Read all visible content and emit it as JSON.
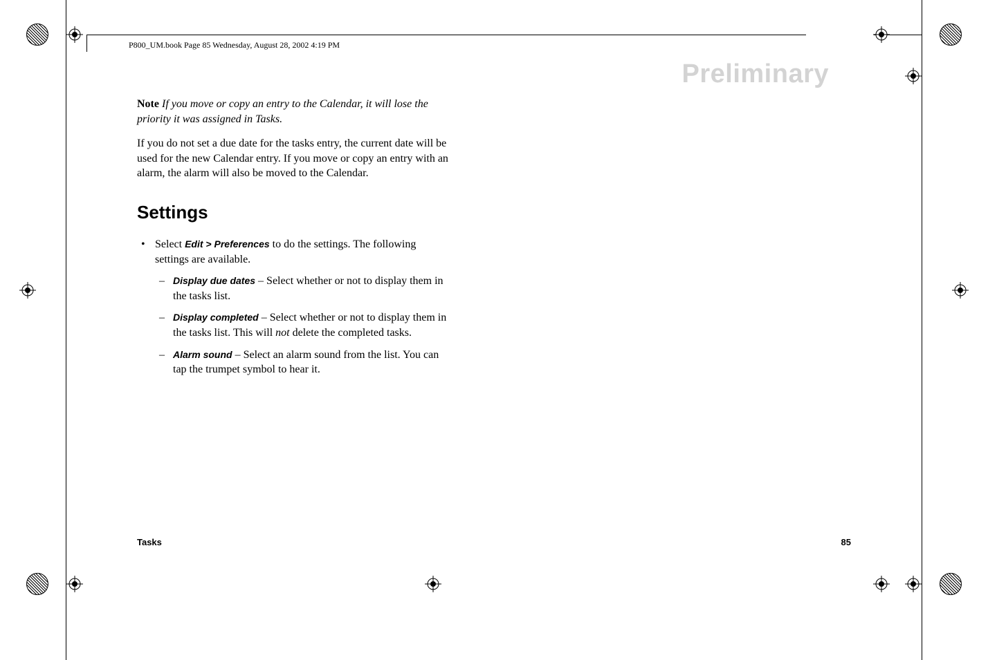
{
  "header": {
    "bookline": "P800_UM.book  Page 85  Wednesday, August 28, 2002  4:19 PM"
  },
  "watermark": "Preliminary",
  "note": {
    "label": "Note",
    "text": " If you move or copy an entry to the Calendar, it will lose the priority it was assigned in Tasks."
  },
  "body_para": "If you do not set a due date for the tasks entry, the current date will be used for the new Calendar entry. If you move or copy an entry with an alarm, the alarm will also be moved to the Calendar.",
  "section_heading": "Settings",
  "bullet": {
    "pre": "Select ",
    "label": "Edit > Preferences",
    "post": " to do the settings. The following settings are available."
  },
  "subitems": [
    {
      "label": "Display due dates",
      "post": " – Select whether or not to display them in the tasks list."
    },
    {
      "label": "Display completed",
      "post_pre": " – Select whether or not to display them in the tasks list. This will ",
      "post_italic": "not",
      "post_after": " delete the completed tasks."
    },
    {
      "label": "Alarm sound",
      "post": " – Select an alarm sound from the list. You can tap the trumpet symbol to hear it."
    }
  ],
  "footer": {
    "left": "Tasks",
    "right": "85"
  }
}
